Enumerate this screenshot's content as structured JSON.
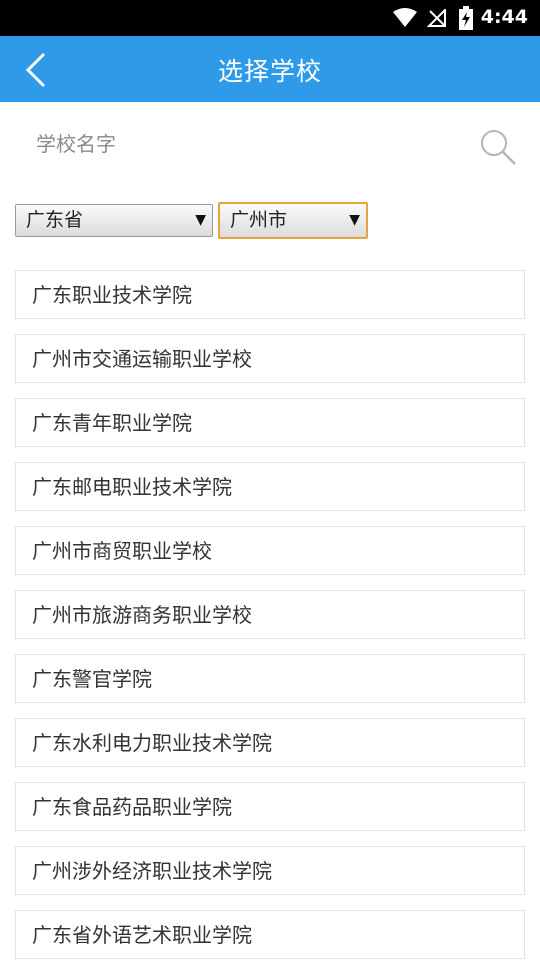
{
  "status_bar": {
    "time": "4:44",
    "icons": [
      "wifi-icon",
      "no-signal-icon",
      "battery-charging-icon"
    ]
  },
  "app_bar": {
    "title": "选择学校",
    "back_icon": "chevron-left-icon"
  },
  "search": {
    "placeholder": "学校名字",
    "icon": "search-icon"
  },
  "filters": {
    "province": {
      "value": "广东省"
    },
    "city": {
      "value": "广州市"
    }
  },
  "schools": [
    {
      "name": "广东职业技术学院"
    },
    {
      "name": "广州市交通运输职业学校"
    },
    {
      "name": "广东青年职业学院"
    },
    {
      "name": "广东邮电职业技术学院"
    },
    {
      "name": "广州市商贸职业学校"
    },
    {
      "name": "广州市旅游商务职业学校"
    },
    {
      "name": "广东警官学院"
    },
    {
      "name": "广东水利电力职业技术学院"
    },
    {
      "name": "广东食品药品职业学院"
    },
    {
      "name": "广州涉外经济职业技术学院"
    },
    {
      "name": "广东省外语艺术职业学院"
    }
  ],
  "colors": {
    "app_bar": "#2f9be8",
    "focus_border": "#e8a43a"
  }
}
